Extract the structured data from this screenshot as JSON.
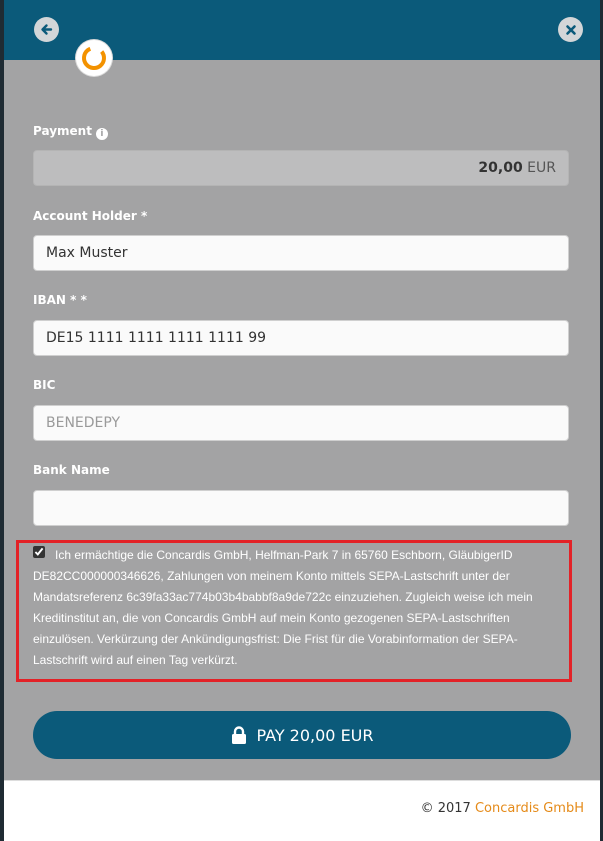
{
  "payment": {
    "label": "Payment",
    "amount": "20,00",
    "currency": "EUR"
  },
  "account_holder": {
    "label": "Account Holder *",
    "value": "Max Muster"
  },
  "iban": {
    "label": "IBAN * *",
    "value": "DE15 1111 1111 1111 1111 99"
  },
  "bic": {
    "label": "BIC",
    "placeholder": "BENEDEPY"
  },
  "bank_name": {
    "label": "Bank Name",
    "value": ""
  },
  "mandate": {
    "checked": true,
    "text": "Ich ermächtige die Concardis GmbH, Helfman-Park 7 in 65760 Eschborn, GläubigerID DE82CC000000346626, Zahlungen von meinem Konto mittels SEPA-Lastschrift unter der Mandatsreferenz 6c39fa33ac774b03b4babbf8a9de722c einzuziehen. Zugleich weise ich mein Kreditinstitut an, die von Concardis GmbH auf mein Konto gezogenen SEPA-Lastschriften einzulösen. Verkürzung der Ankündigungsfrist: Die Frist für die Vorabinformation der SEPA-Lastschrift wird auf einen Tag verkürzt."
  },
  "pay_button": {
    "label": "PAY 20,00 EUR"
  },
  "footer": {
    "copyright": "© 2017",
    "brand": "Concardis GmbH"
  },
  "icons": {
    "back": "arrow-left-icon",
    "close": "close-icon",
    "info": "info-icon",
    "lock": "lock-icon",
    "logo": "concardis-logo"
  },
  "colors": {
    "header": "#0b5a7a",
    "background": "#a3a3a4",
    "highlight": "#e32227",
    "brand": "#e58b1a",
    "logo_orange": "#f39200"
  }
}
